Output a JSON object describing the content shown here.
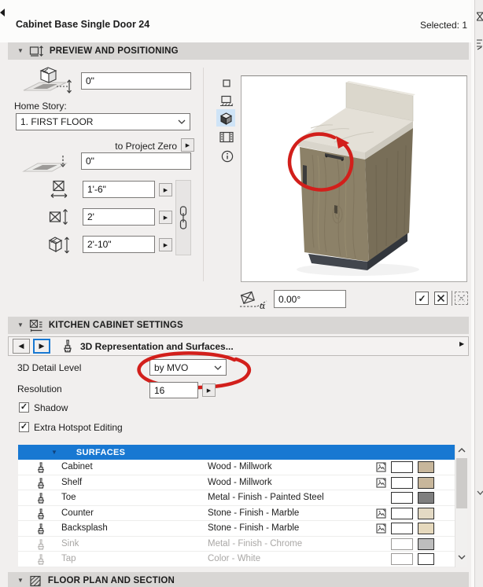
{
  "titlebar": {
    "title": "Cabinet Base Single Door 24",
    "selected": "Selected: 1"
  },
  "preview": {
    "header": "PREVIEW AND POSITIONING",
    "top_elevation": "0\"",
    "home_story_label": "Home Story:",
    "home_story": "1. FIRST FLOOR",
    "anchor_label": "to Project Zero",
    "bottom_elevation": "0\"",
    "width": "1'-6\"",
    "depth": "2'",
    "height": "2'-10\"",
    "rotation": "0.00°"
  },
  "settings": {
    "header": "KITCHEN CABINET SETTINGS",
    "tab": "3D Representation and Surfaces...",
    "detail_label": "3D Detail Level",
    "detail_value": "by MVO",
    "resolution_label": "Resolution",
    "resolution_value": "16",
    "shadow_label": "Shadow",
    "shadow_checked": true,
    "extra_hotspot_label": "Extra Hotspot Editing",
    "extra_hotspot_checked": true
  },
  "surfaces": {
    "header": "SURFACES",
    "rows": [
      {
        "name": "Cabinet",
        "material": "Wood - Millwork",
        "has_texture": true,
        "swatch": "#c7b69b",
        "enabled": true
      },
      {
        "name": "Shelf",
        "material": "Wood - Millwork",
        "has_texture": true,
        "swatch": "#c7b69b",
        "enabled": true
      },
      {
        "name": "Toe",
        "material": "Metal - Finish - Painted Steel",
        "has_texture": false,
        "swatch": "#7f7f7f",
        "enabled": true
      },
      {
        "name": "Counter",
        "material": "Stone - Finish - Marble",
        "has_texture": true,
        "swatch": "#e3d9c4",
        "enabled": true
      },
      {
        "name": "Backsplash",
        "material": "Stone - Finish - Marble",
        "has_texture": true,
        "swatch": "#e6d9bd",
        "enabled": true
      },
      {
        "name": "Sink",
        "material": "Metal - Finish - Chrome",
        "has_texture": false,
        "swatch": "#bdbdbd",
        "enabled": false
      },
      {
        "name": "Tap",
        "material": "Color - White",
        "has_texture": false,
        "swatch": "#ffffff",
        "enabled": false
      }
    ]
  },
  "floorplan": {
    "header": "FLOOR PLAN AND SECTION"
  },
  "glyphs": {
    "collapse": "▼",
    "flyout": "▶",
    "nav_left": "◀",
    "nav_right": "▶",
    "mini_right": "▶",
    "check": "✓"
  },
  "colors": {
    "accent_blue": "#1878d2",
    "annotation_red": "#d21f1b",
    "selected_tool_bg": "#cfe4f7"
  }
}
